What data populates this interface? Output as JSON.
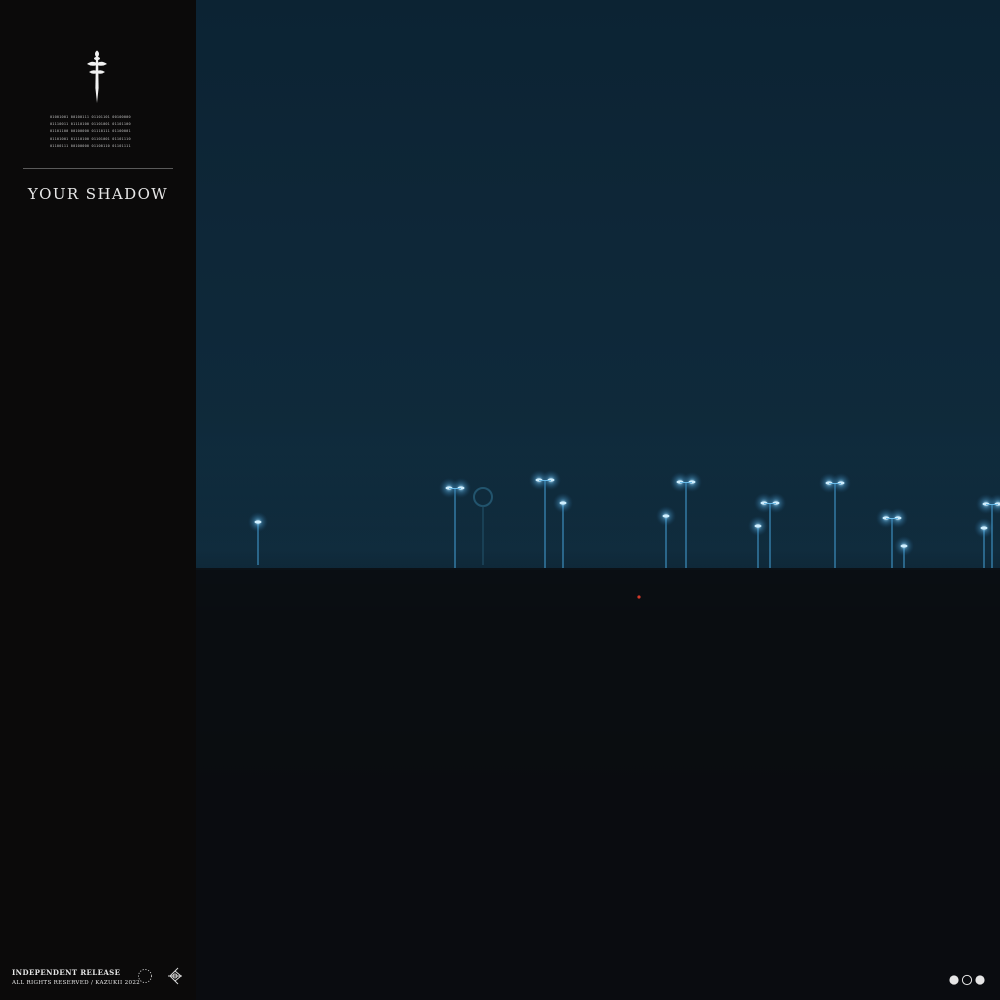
{
  "cover": {
    "title": "YOUR SHADOW",
    "code_lines": [
      "01001001 00100111 01101101 00100000",
      "01110011 01110100 01101001 01101100",
      "01101100 00100000 01110111 01100001",
      "01101001 01110100 01101001 01101110",
      "01100111 00100000 01100110 01101111"
    ],
    "footer": {
      "release": "INDEPENDENT RELEASE",
      "rights": "ALL RIGHTS RESERVED / KAZUKII 2022"
    }
  },
  "icons": {
    "emblem": "dagger-cross-icon",
    "circle": "dotted-circle-icon",
    "logo": "kazukii-logo-icon",
    "dots": "three-dots-icon"
  },
  "colors": {
    "sidebar": "#0b0a0a",
    "sky": "#0f2a3b",
    "ground": "#0b0d11",
    "lamp": "#8fd6ff",
    "text": "#e8e8e8"
  }
}
